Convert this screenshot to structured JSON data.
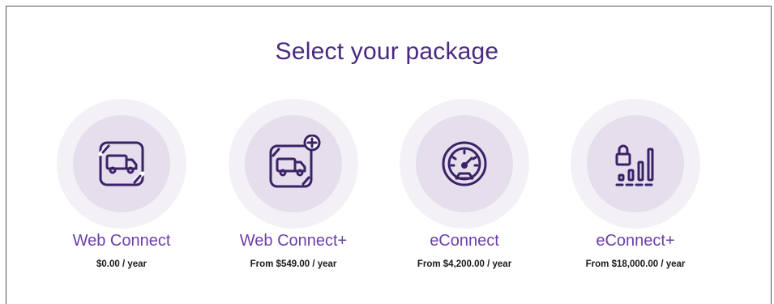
{
  "header": {
    "title": "Select your package"
  },
  "packages": [
    {
      "name": "Web Connect",
      "price": "$0.00 / year",
      "icon": "truck-icon"
    },
    {
      "name": "Web Connect+",
      "price": "From $549.00 / year",
      "icon": "truck-plus-icon"
    },
    {
      "name": "eConnect",
      "price": "From $4,200.00 / year",
      "icon": "speedometer-icon"
    },
    {
      "name": "eConnect+",
      "price": "From $18,000.00 / year",
      "icon": "lock-bars-icon"
    }
  ],
  "colors": {
    "title": "#4a2a80",
    "accent": "#6a3fa8",
    "icon_stroke": "#3b2266",
    "circle_outer": "#f3f1f6",
    "circle_inner": "#e5dfed"
  }
}
